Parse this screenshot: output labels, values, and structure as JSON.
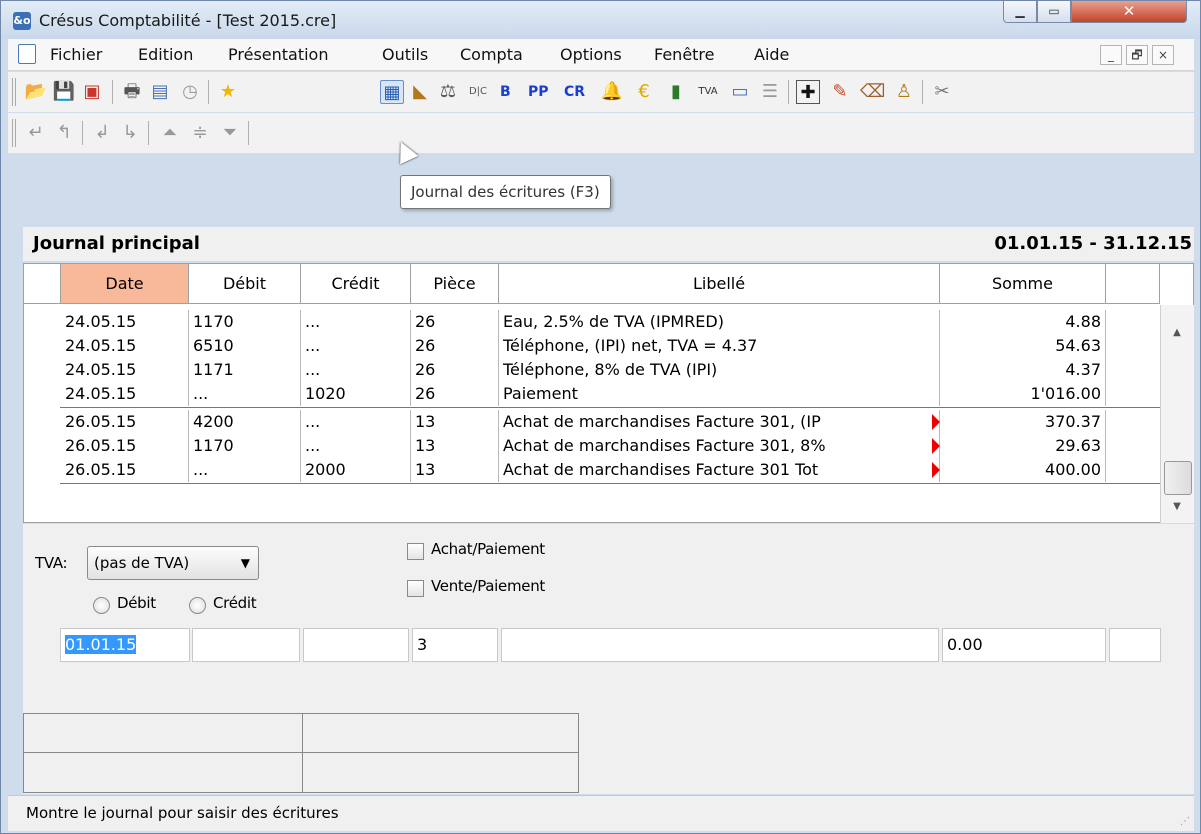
{
  "window": {
    "title": "Crésus Comptabilité - [Test 2015.cre]",
    "app_icon_text": "&o",
    "close_glyph": "✕",
    "min_glyph": "▁",
    "max_glyph": "▭"
  },
  "menu": {
    "items": [
      "Fichier",
      "Edition",
      "Présentation",
      "Outils",
      "Compta",
      "Options",
      "Fenêtre",
      "Aide"
    ],
    "mdi_min": "_",
    "mdi_restore": "🗗",
    "mdi_close": "×"
  },
  "toolbar": {
    "text_buttons": [
      "B",
      "PP",
      "CR"
    ],
    "tva_label": "TVA",
    "dc_label": "D|C"
  },
  "tooltip": {
    "text": "Journal des écritures (F3)"
  },
  "journal": {
    "title": "Journal principal",
    "period": "01.01.15 - 31.12.15",
    "columns": [
      "Date",
      "Débit",
      "Crédit",
      "Pièce",
      "Libellé",
      "Somme"
    ],
    "rows": [
      {
        "date": "24.05.15",
        "debit": "1170",
        "credit": "...",
        "piece": "26",
        "libelle": "Eau, 2.5% de TVA (IPMRED)",
        "somme": "4.88",
        "mark": false
      },
      {
        "date": "24.05.15",
        "debit": "6510",
        "credit": "...",
        "piece": "26",
        "libelle": "Téléphone, (IPI) net, TVA = 4.37",
        "somme": "54.63",
        "mark": false
      },
      {
        "date": "24.05.15",
        "debit": "1171",
        "credit": "...",
        "piece": "26",
        "libelle": "Téléphone, 8% de TVA (IPI)",
        "somme": "4.37",
        "mark": false
      },
      {
        "date": "24.05.15",
        "debit": "...",
        "credit": "1020",
        "piece": "26",
        "libelle": "Paiement",
        "somme": "1'016.00",
        "mark": false
      },
      {
        "date": "26.05.15",
        "debit": "4200",
        "credit": "...",
        "piece": "13",
        "libelle": "Achat de marchandises Facture 301, (IP",
        "somme": "370.37",
        "mark": true
      },
      {
        "date": "26.05.15",
        "debit": "1170",
        "credit": "...",
        "piece": "13",
        "libelle": "Achat de marchandises Facture 301, 8%",
        "somme": "29.63",
        "mark": true
      },
      {
        "date": "26.05.15",
        "debit": "...",
        "credit": "2000",
        "piece": "13",
        "libelle": "Achat de marchandises Facture 301 Tot",
        "somme": "400.00",
        "mark": true
      }
    ]
  },
  "entry": {
    "tva_label": "TVA:",
    "tva_value": "(pas de TVA)",
    "radio_debit": "Débit",
    "radio_credit": "Crédit",
    "chk_achat": "Achat/Paiement",
    "chk_vente": "Vente/Paiement",
    "date_value": "01.01.15",
    "piece_value": "3",
    "somme_value": "0.00"
  },
  "status": {
    "text": "Montre le journal pour saisir des écritures"
  },
  "colors": {
    "header_selected": "#f8b89a",
    "red_mark": "#ee0000",
    "accent": "#3399ff"
  }
}
